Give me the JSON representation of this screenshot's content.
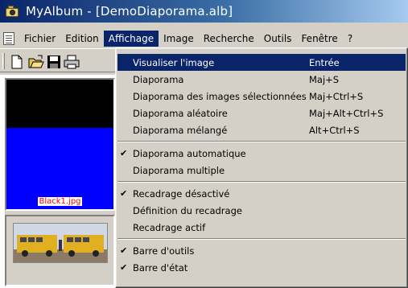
{
  "window": {
    "title": "MyAlbum - [DemoDiaporama.alb]"
  },
  "menubar": {
    "items": [
      {
        "label": "Fichier"
      },
      {
        "label": "Edition"
      },
      {
        "label": "Affichage"
      },
      {
        "label": "Image"
      },
      {
        "label": "Recherche"
      },
      {
        "label": "Outils"
      },
      {
        "label": "Fenêtre"
      },
      {
        "label": "?"
      }
    ]
  },
  "toolbar": {
    "buttons": [
      {
        "icon": "new-file-icon"
      },
      {
        "icon": "open-folder-icon"
      },
      {
        "icon": "save-icon"
      },
      {
        "icon": "print-icon"
      }
    ]
  },
  "thumbnails": {
    "first": {
      "filename": "Black1.jpg",
      "colors": {
        "top": "#000000",
        "bottom": "#0000ff"
      }
    },
    "second": {
      "description_icon": "bus-photo-thumbnail"
    }
  },
  "dropdown": {
    "menu": "Affichage",
    "groups": [
      [
        {
          "label": "Visualiser l'image",
          "shortcut": "Entrée",
          "checked": false,
          "highlighted": true
        },
        {
          "label": "Diaporama",
          "shortcut": "Maj+S",
          "checked": false
        },
        {
          "label": "Diaporama des images sélectionnées",
          "shortcut": "Maj+Ctrl+S",
          "checked": false
        },
        {
          "label": "Diaporama aléatoire",
          "shortcut": "Maj+Alt+Ctrl+S",
          "checked": false
        },
        {
          "label": "Diaporama mélangé",
          "shortcut": "Alt+Ctrl+S",
          "checked": false
        }
      ],
      [
        {
          "label": "Diaporama automatique",
          "shortcut": "",
          "checked": true
        },
        {
          "label": "Diaporama multiple",
          "shortcut": "",
          "checked": false
        }
      ],
      [
        {
          "label": "Recadrage désactivé",
          "shortcut": "",
          "checked": true
        },
        {
          "label": "Définition du recadrage",
          "shortcut": "",
          "checked": false
        },
        {
          "label": "Recadrage actif",
          "shortcut": "",
          "checked": false
        }
      ],
      [
        {
          "label": "Barre d'outils",
          "shortcut": "",
          "checked": true
        },
        {
          "label": "Barre d'état",
          "shortcut": "",
          "checked": true
        }
      ]
    ],
    "check_glyph": "✔"
  },
  "colors": {
    "title_bar": "#0a246a",
    "highlight": "#0a246a",
    "face": "#d4d0c8"
  }
}
